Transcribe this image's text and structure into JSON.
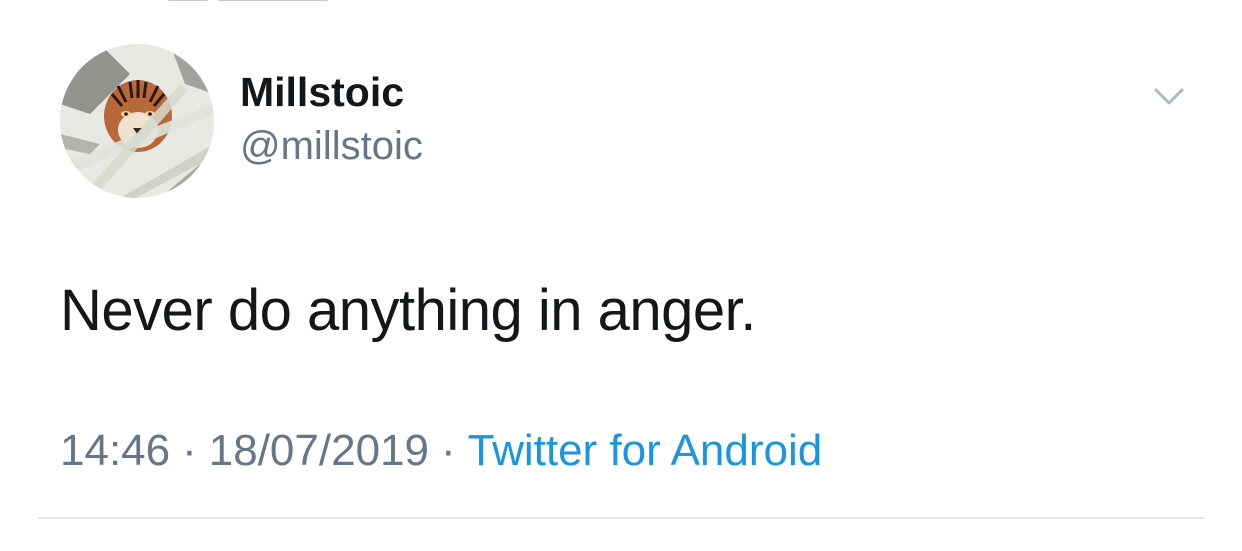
{
  "tweet": {
    "display_name": "Millstoic",
    "handle": "@millstoic",
    "text": "Never do anything in anger.",
    "time": "14:46",
    "date": "18/07/2019",
    "separator": "·",
    "source": "Twitter for Android"
  },
  "icons": {
    "avatar": "tiger-avatar",
    "menu": "chevron-down-icon"
  },
  "colors": {
    "primary_text": "#14171a",
    "secondary_text": "#657786",
    "link": "#1b95e0",
    "divider": "#e1e8ed",
    "background": "#ffffff"
  }
}
